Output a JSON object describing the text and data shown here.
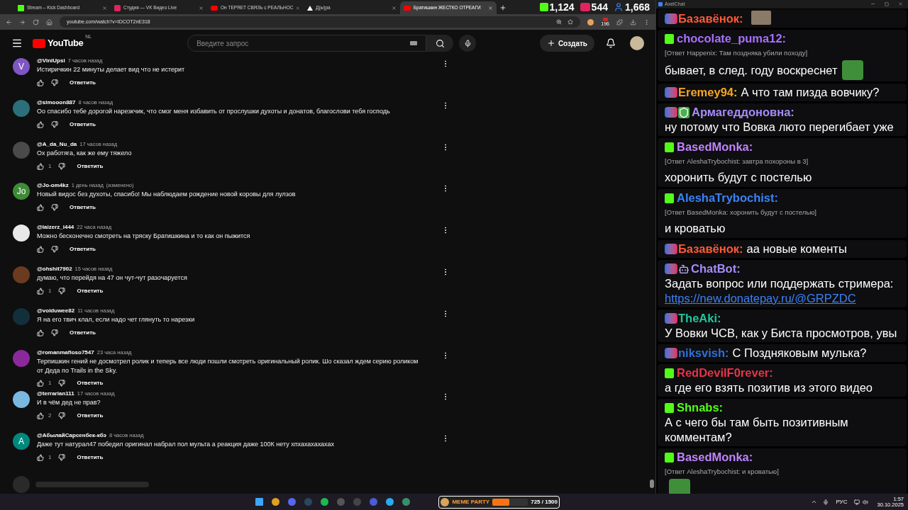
{
  "browser": {
    "tabs": [
      {
        "title": "Stream – Kick Dashboard",
        "kind": "kick",
        "selected": false
      },
      {
        "title": "Студия — VK Видео Live",
        "kind": "vk",
        "selected": false
      },
      {
        "title": "Он ТЕРЯЕТ СВЯЗЬ с РЕАЛЬНОС",
        "kind": "youtube",
        "selected": false
      },
      {
        "title": "Д(ы)ра",
        "kind": "plain",
        "selected": false
      },
      {
        "title": "Братишкин ЖЕСТКО ОТРЕАГИ",
        "kind": "youtube",
        "selected": true
      }
    ],
    "stats": [
      {
        "kind": "kick",
        "value": "1,124"
      },
      {
        "kind": "live",
        "value": "544"
      },
      {
        "kind": "viewers",
        "value": "1,668"
      }
    ],
    "address": "youtube.com/watch?v=IDCOT2nE318",
    "extension_badge": "196"
  },
  "youtube": {
    "logo_text": "YouTube",
    "region": "NL",
    "search": {
      "placeholder": "Введите запрос"
    },
    "create_button": "Создать",
    "comments": [
      {
        "author": "@ViniUpsi",
        "time": "7 часов назад",
        "text": "Истиричкин  22 минуты делает вид что не истерит",
        "avatar": {
          "kind": "letter",
          "letter": "V",
          "color": "#7e57c2"
        },
        "reply": "Ответить"
      },
      {
        "author": "@simooon887",
        "time": "8 часов назад",
        "text": "Оо спасибо тебе дорогой нарезкчик, что смог меня избавить от прослушки  духоты и донатов, благослови тебя господь",
        "avatar": {
          "kind": "image",
          "color": "#2b6f7a"
        },
        "reply": "Ответить"
      },
      {
        "author": "@A_da_Nu_da",
        "time": "17 часов назад",
        "text": "Ох работяга, как же ему тяжело",
        "likes": "1",
        "avatar": {
          "kind": "image",
          "color": "#4a4a4a"
        },
        "reply": "Ответить"
      },
      {
        "author": "@Jo-om4kz",
        "time": "1 день назад",
        "edited": "(изменено)",
        "text": "Новый видос без духоты, спасибо! Мы наблюдаем рождение новой коровы для лулзов",
        "avatar": {
          "kind": "letter",
          "letter": "Jo",
          "color": "#3d8b37"
        },
        "reply": "Ответить"
      },
      {
        "author": "@laizerz_i444",
        "time": "22 часа назад",
        "text": "Можно бесконечно смотреть на тряску Братишкина и то как он пыжится",
        "avatar": {
          "kind": "image",
          "color": "#e8e8e8"
        },
        "reply": "Ответить"
      },
      {
        "author": "@ohshit7902",
        "time": "15 часов назад",
        "text": "думаю, что перейдя на 47 он чут-чут разочаруется",
        "likes": "1",
        "avatar": {
          "kind": "image",
          "color": "#6b3b1f"
        },
        "reply": "Ответить"
      },
      {
        "author": "@voiduwee82",
        "time": "11 часов назад",
        "text": "Я на его твич клал, если надо чет глянуть то нарезки",
        "avatar": {
          "kind": "image",
          "color": "#12303c"
        },
        "reply": "Ответить"
      },
      {
        "author": "@romanmafioso7547",
        "time": "23 часа назад",
        "text": "Терпишкин гений не досмотрел ролик и теперь все люди пошли смотреть оригинальный ролик. Шо сказал ждем серию роликом от Деда по Trails in the Sky.",
        "likes": "1",
        "avatar": {
          "kind": "image",
          "color": "#8a2a9a"
        },
        "reply": "Ответить"
      },
      {
        "author": "@terrarian111",
        "time": "17 часов назад",
        "text": "И в чём дед не прав?",
        "likes": "2",
        "avatar": {
          "kind": "image",
          "color": "#7ab8e0"
        },
        "reply": "Ответить"
      },
      {
        "author": "@АбылайСарсенбек-кбэ",
        "time": "8 часов назад",
        "text": "Даже тут натурал47 победил оригинал набрал пол мульта а реакция даже 100К нету хпхахахахахах",
        "likes": "1",
        "avatar": {
          "kind": "letter",
          "letter": "A",
          "color": "#00897b"
        },
        "reply": "Ответить"
      }
    ]
  },
  "chat": {
    "title": "AxelChat",
    "messages": [
      {
        "kind": "vk",
        "author": "Базавёнок:",
        "color": "#ff5a36",
        "emote": true
      },
      {
        "kind": "kick",
        "author": "chocolate_puma12:",
        "color": "#a970ff",
        "reply_note": "[Ответ Happenix: Там позднякa убили походу]",
        "text": "бывает, в след. году воскреснет",
        "emote": true
      },
      {
        "kind": "vk",
        "author": "Eremey94:",
        "color": "#f5a623",
        "text": "А что там пизда вовчику?"
      },
      {
        "kind": "vk",
        "badges": [
          {
            "kind": "shield"
          }
        ],
        "author": "Армагеддоновна:",
        "color": "#a78bfa",
        "text": "ну потому что Вовка люто перегибает уже"
      },
      {
        "kind": "kick",
        "author": "BasedMonka:",
        "color": "#c084fc",
        "reply_note": "[Ответ AleshaTrybochist: завтра похороны в 3]",
        "text": "хоронить будут с постелью"
      },
      {
        "kind": "kick",
        "author": "AleshaTrybochist:",
        "color": "#3b82f6",
        "reply_note": "[Ответ BasedMonka: хоронить будут с постелью]",
        "text": "и кроватью"
      },
      {
        "kind": "vk",
        "author": "Базавёнок:",
        "color": "#ff5a36",
        "text": "аа новые коменты"
      },
      {
        "kind": "vk",
        "badges": [
          {
            "kind": "bot"
          }
        ],
        "author": "ChatBot:",
        "color": "#a78bfa",
        "text": "Задать вопрос или поддержать стримера:",
        "link": "https://new.donatepay.ru/@GRPZDC"
      },
      {
        "kind": "vk",
        "author": "TheAki:",
        "color": "#22c59a",
        "text": "У Вовки ЧСВ, как у Биста просмотров, увы"
      },
      {
        "kind": "vk",
        "author": "niksvish:",
        "color": "#2f6fd6",
        "text": "С Поздняковым мулька?"
      },
      {
        "kind": "kick",
        "author": "RedDevilF0rever:",
        "color": "#e5344a",
        "text": "а где его взять позитив из этого видео"
      },
      {
        "kind": "kick",
        "author": "Shnabs:",
        "color": "#53fc18",
        "text": "А с чего бы там быть позитивным комментам?"
      },
      {
        "kind": "kick",
        "author": "BasedMonka:",
        "color": "#c084fc",
        "reply_note": "[Ответ AleshaTrybochist: и кроватью]",
        "emote": true
      }
    ]
  },
  "taskbar": {
    "widget": {
      "title": "MEME PARTY",
      "reading": "725 / 1500",
      "level": 0.483
    },
    "language": "РУС",
    "time": "1:57",
    "date": "30.10.2025"
  }
}
